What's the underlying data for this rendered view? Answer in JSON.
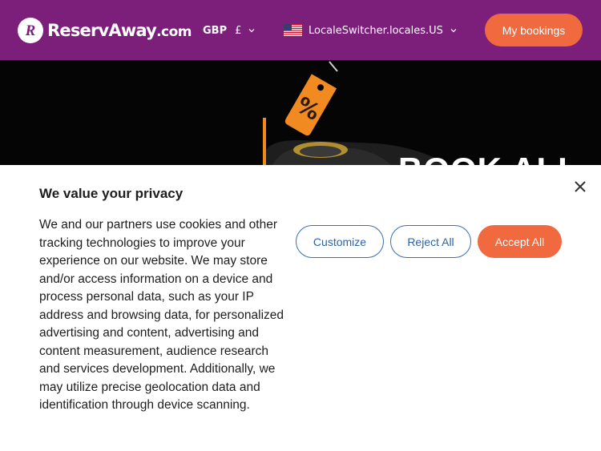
{
  "header": {
    "logo": {
      "brand": "ReservAway",
      "suffix": ".com"
    },
    "currency": {
      "code": "GBP",
      "symbol": "£"
    },
    "locale": {
      "label": "LocaleSwitcher.locales.US",
      "flag": "us-flag-icon"
    },
    "my_bookings_label": "My bookings"
  },
  "hero": {
    "headline": "BOOK ALL",
    "icon": "discount-tag-icon"
  },
  "consent": {
    "title": "We value your privacy",
    "body": "We and our partners use cookies and other tracking technologies to improve your experience on our website. We may store and/or access information on a device and process personal data, such as your IP address and browsing data, for personalized advertising and content, advertising and content measurement, audience research and services development. Additionally, we may utilize precise geolocation data and identification through device scanning.",
    "customize_label": "Customize",
    "reject_label": "Reject All",
    "accept_label": "Accept All",
    "close_icon": "close-icon"
  },
  "colors": {
    "header_bg": "#7b1f7a",
    "accent": "#f0693f",
    "outline": "#3c6fb0",
    "hero_bg": "#050505"
  }
}
